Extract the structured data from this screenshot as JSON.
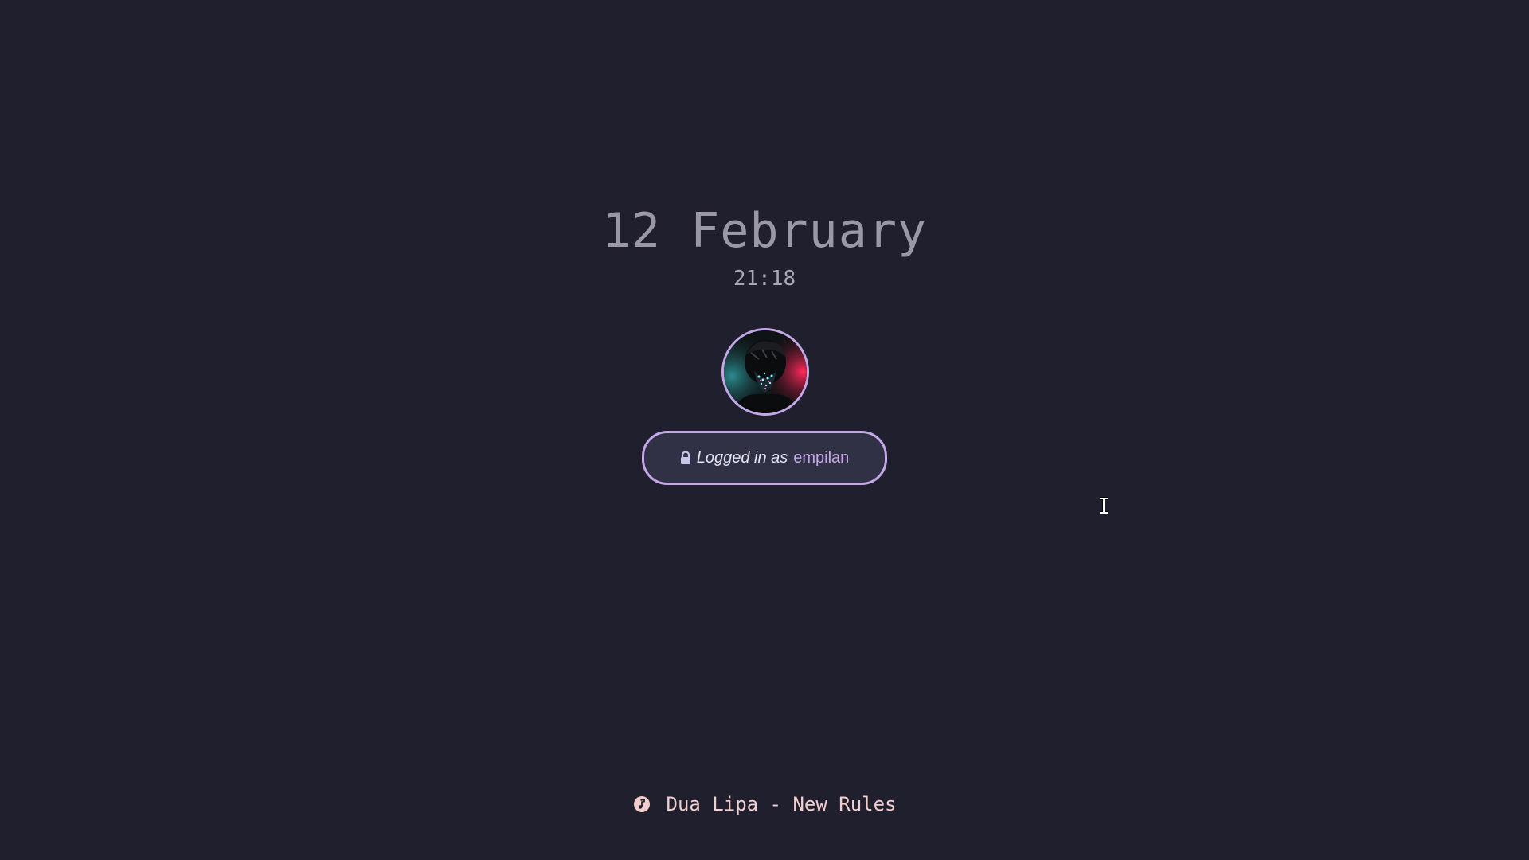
{
  "lockscreen": {
    "date": "12 February",
    "time": "21:18",
    "login": {
      "prefix": "Logged in as",
      "username": "empilan",
      "icon": "lock-icon"
    },
    "media": {
      "icon": "music-note-icon",
      "now_playing": "Dua Lipa - New Rules"
    },
    "avatar": {
      "icon": "user-avatar"
    }
  },
  "colors": {
    "background": "#1f1f2e",
    "accent": "#c4a7e7",
    "pill_fill": "#313146",
    "date_text": "#9a98a6",
    "media_text": "#f2cdcd"
  }
}
